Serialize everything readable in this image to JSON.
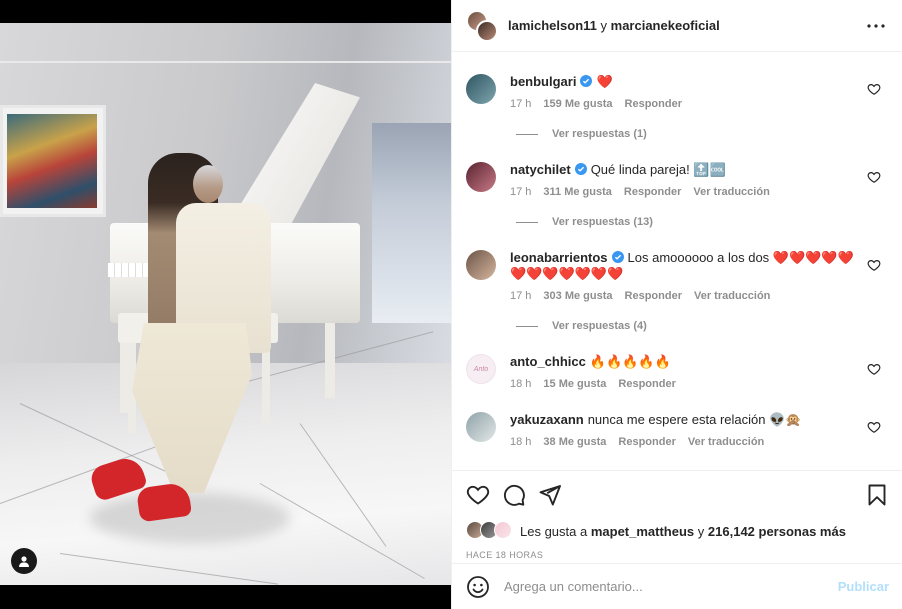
{
  "header": {
    "user1": "lamichelson11",
    "conjunction": "y",
    "user2": "marcianekeoficial",
    "more_icon": "more-horizontal-icon"
  },
  "comments": [
    {
      "username": "benbulgari",
      "verified": true,
      "text": "❤️",
      "time": "17 h",
      "likes": "159 Me gusta",
      "reply": "Responder",
      "translate": "",
      "replies": "Ver respuestas (1)",
      "avatar_color": "#4f7a86"
    },
    {
      "username": "natychilet",
      "verified": true,
      "text": "Qué linda pareja! 🔝🆒",
      "time": "17 h",
      "likes": "311 Me gusta",
      "reply": "Responder",
      "translate": "Ver traducción",
      "replies": "Ver respuestas (13)",
      "avatar_color": "#8d3c4a"
    },
    {
      "username": "leonabarrientos",
      "verified": true,
      "text": "Los amoooooo a los dos ❤️❤️❤️❤️❤️❤️❤️❤️❤️❤️❤️❤️",
      "time": "17 h",
      "likes": "303 Me gusta",
      "reply": "Responder",
      "translate": "Ver traducción",
      "replies": "Ver respuestas (4)",
      "avatar_color": "#a98670"
    },
    {
      "username": "anto_chhicc",
      "verified": false,
      "text": "🔥🔥🔥🔥🔥",
      "time": "18 h",
      "likes": "15 Me gusta",
      "reply": "Responder",
      "translate": "",
      "replies": "",
      "avatar_color": "#f3e9ee"
    },
    {
      "username": "yakuzaxann",
      "verified": false,
      "text": "nunca me espere esta relación 👽🙊",
      "time": "18 h",
      "likes": "38 Me gusta",
      "reply": "Responder",
      "translate": "Ver traducción",
      "replies": "",
      "avatar_color": "#b9c6c9"
    }
  ],
  "actions": {
    "like_icon": "heart-icon",
    "comment_icon": "comment-icon",
    "share_icon": "paper-plane-icon",
    "save_icon": "bookmark-icon"
  },
  "likes": {
    "prefix": "Les gusta a",
    "user": "mapet_mattheus",
    "conj": "y",
    "count": "216,142 personas más"
  },
  "time_ago": "HACE 18 HORAS",
  "add_comment": {
    "placeholder": "Agrega un comentario...",
    "publish": "Publicar"
  },
  "colors": {
    "verified": "#3897f0",
    "publish_disabled": "#b2dffc",
    "muted": "#8e8e8e",
    "text": "#262626"
  }
}
